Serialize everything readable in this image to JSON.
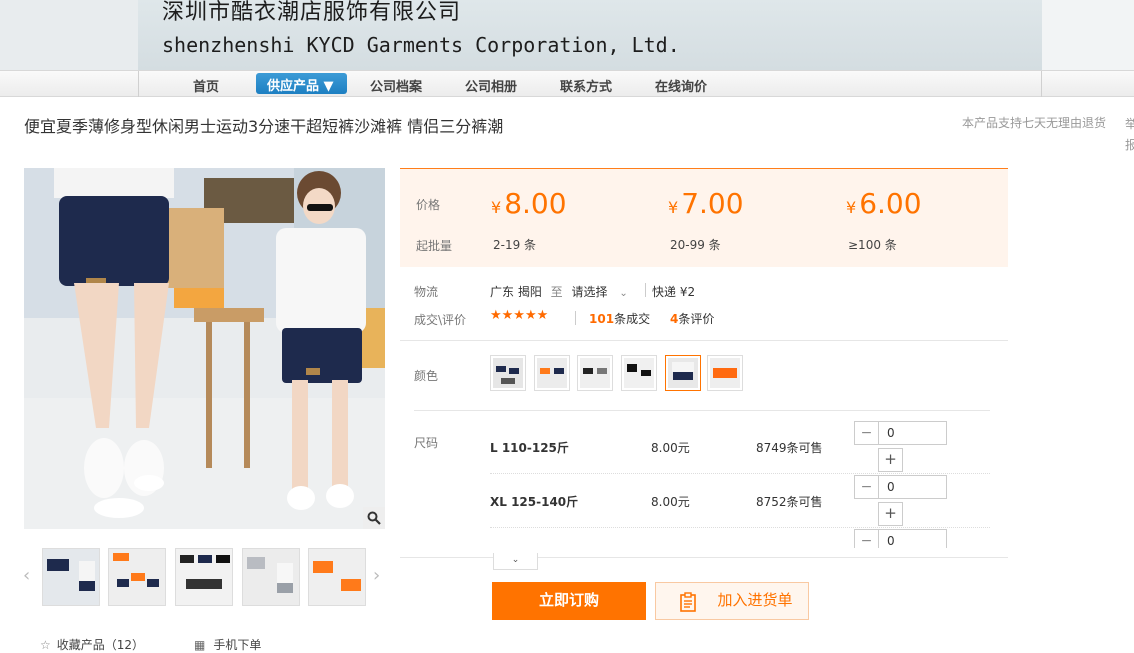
{
  "header": {
    "company_cn": "深圳市酷衣潮店服饰有限公司",
    "company_en": "shenzhenshi KYCD Garments Corporation, Ltd."
  },
  "nav": {
    "home": "首页",
    "products": "供应产品 ▼",
    "profile": "公司档案",
    "album": "公司相册",
    "contact": "联系方式",
    "inquiry": "在线询价"
  },
  "product": {
    "title": "便宜夏季薄修身型休闲男士运动3分速干超短裤沙滩裤 情侣三分裤潮",
    "return_note": "本产品支持七天无理由退货",
    "edge_chars": "举报"
  },
  "pricing": {
    "price_label": "价格",
    "moq_label": "起批量",
    "currency": "¥",
    "tiers": [
      {
        "price": "8.00",
        "qty": "2-19 条"
      },
      {
        "price": "7.00",
        "qty": "20-99 条"
      },
      {
        "price": "6.00",
        "qty": "≥100 条"
      }
    ]
  },
  "logistics": {
    "label": "物流",
    "from": "广东 揭阳",
    "to_word": "至",
    "select": "请选择",
    "express": "快递 ¥2"
  },
  "deals": {
    "label": "成交\\评价",
    "stars": "★★★★★",
    "deal_count": "101",
    "deal_suffix": "条成交",
    "review_count": "4",
    "review_suffix": "条评价"
  },
  "colors": {
    "label": "颜色",
    "selected_index": 4
  },
  "sizes": {
    "label": "尺码",
    "rows": [
      {
        "name": "L 110-125斤",
        "price": "8.00元",
        "stock": "8749条可售",
        "qty": "0"
      },
      {
        "name": "XL 125-140斤",
        "price": "8.00元",
        "stock": "8752条可售",
        "qty": "0"
      },
      {
        "name": "",
        "price": "",
        "stock": "",
        "qty": "0"
      }
    ]
  },
  "stepper": {
    "minus": "−",
    "plus": "+"
  },
  "actions": {
    "expand": "⌄",
    "buy": "立即订购",
    "cart": "加入进货单"
  },
  "footer": {
    "favorite": "收藏产品（12）",
    "mobile_order": "手机下单"
  },
  "theme": {
    "accent": "#ff7300",
    "price_bg": "#fff4ec",
    "nav_active": "#1d7fc2"
  }
}
